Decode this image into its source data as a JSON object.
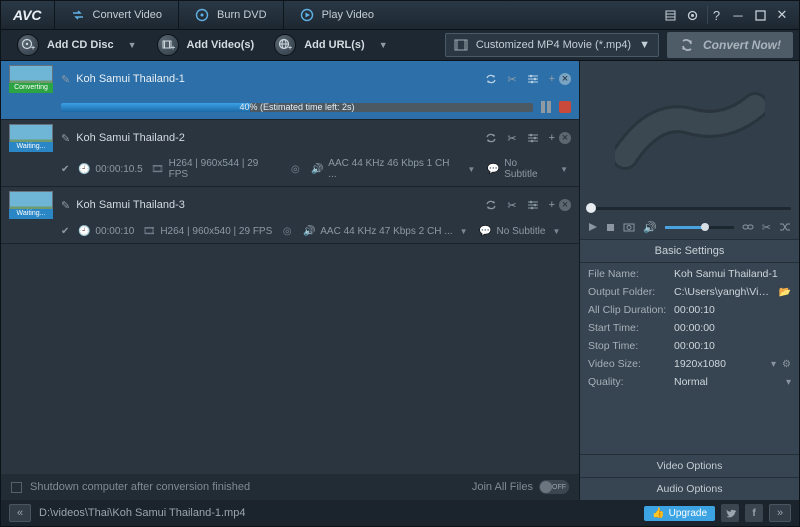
{
  "app": {
    "logo": "AVC"
  },
  "tabs": {
    "convert": "Convert Video",
    "burn": "Burn DVD",
    "play": "Play Video"
  },
  "toolbar": {
    "add_cd": "Add CD Disc",
    "add_videos": "Add Video(s)",
    "add_urls": "Add URL(s)",
    "profile": "Customized MP4 Movie (*.mp4)",
    "convert_now": "Convert Now!"
  },
  "files": [
    {
      "name": "Koh Samui Thailand-1",
      "status": "Converting",
      "progress_pct": 40,
      "progress_text": "40% (Estimated time left: 2s)"
    },
    {
      "name": "Koh Samui Thailand-2",
      "status": "Waiting...",
      "duration": "00:00:10.5",
      "video": "H264 | 960x544 | 29 FPS",
      "audio": "AAC 44 KHz 46 Kbps 1 CH ...",
      "subtitle": "No Subtitle"
    },
    {
      "name": "Koh Samui Thailand-3",
      "status": "Waiting...",
      "duration": "00:00:10",
      "video": "H264 | 960x540 | 29 FPS",
      "audio": "AAC 44 KHz 47 Kbps 2 CH ...",
      "subtitle": "No Subtitle"
    }
  ],
  "footer": {
    "shutdown": "Shutdown computer after conversion finished",
    "join": "Join All Files",
    "toggle": "OFF"
  },
  "settings": {
    "title": "Basic Settings",
    "file_name_label": "File Name:",
    "file_name": "Koh Samui Thailand-1",
    "output_label": "Output Folder:",
    "output": "C:\\Users\\yangh\\Videos...",
    "duration_label": "All Clip Duration:",
    "duration": "00:00:10",
    "start_label": "Start Time:",
    "start": "00:00:00",
    "stop_label": "Stop Time:",
    "stop": "00:00:10",
    "size_label": "Video Size:",
    "size": "1920x1080",
    "quality_label": "Quality:",
    "quality": "Normal",
    "video_options": "Video Options",
    "audio_options": "Audio Options"
  },
  "status": {
    "path": "D:\\videos\\Thai\\Koh Samui Thailand-1.mp4",
    "upgrade": "Upgrade"
  }
}
